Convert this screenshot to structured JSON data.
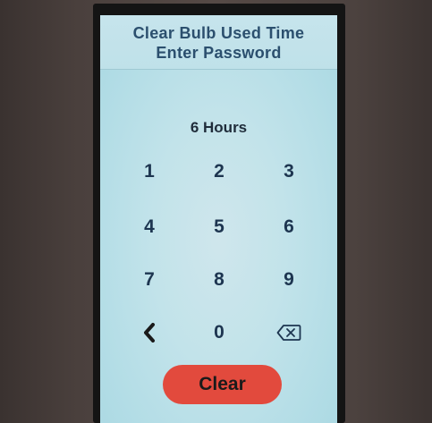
{
  "screen": {
    "title": "Clear Bulb Used Time",
    "subtitle": "Enter Password",
    "hours_label": "6 Hours"
  },
  "keypad": {
    "k1": "1",
    "k2": "2",
    "k3": "3",
    "k4": "4",
    "k5": "5",
    "k6": "6",
    "k7": "7",
    "k8": "8",
    "k9": "9",
    "k0": "0",
    "back_icon": "chevron-left-icon",
    "delete_icon": "backspace-icon"
  },
  "actions": {
    "clear_label": "Clear"
  },
  "colors": {
    "screen_bg": "#c2e3ea",
    "header_text": "#2b4f6e",
    "key_text": "#1d3550",
    "clear_button": "#e24a3d"
  }
}
